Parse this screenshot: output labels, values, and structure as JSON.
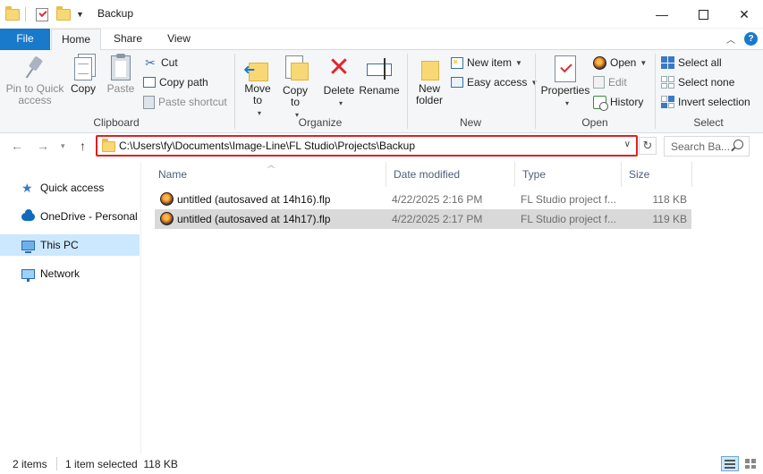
{
  "window": {
    "title": "Backup",
    "minimize": "—",
    "close": "✕"
  },
  "tabs": [
    {
      "label": "File"
    },
    {
      "label": "Home"
    },
    {
      "label": "Share"
    },
    {
      "label": "View"
    }
  ],
  "help_icon_label": "?",
  "ribbon": {
    "clipboard": {
      "label": "Clipboard",
      "pin": "Pin to Quick access",
      "copy": "Copy",
      "paste": "Paste",
      "cut": "Cut",
      "copy_path": "Copy path",
      "paste_shortcut": "Paste shortcut"
    },
    "organize": {
      "label": "Organize",
      "move_to": "Move to",
      "copy_to": "Copy to",
      "delete": "Delete",
      "rename": "Rename"
    },
    "new": {
      "label": "New",
      "new_folder": "New folder",
      "new_item": "New item",
      "easy_access": "Easy access"
    },
    "open": {
      "label": "Open",
      "properties": "Properties",
      "open": "Open",
      "edit": "Edit",
      "history": "History"
    },
    "select": {
      "label": "Select",
      "select_all": "Select all",
      "select_none": "Select none",
      "invert_selection": "Invert selection"
    }
  },
  "address": {
    "path": "C:\\Users\\fy\\Documents\\Image-Line\\FL Studio\\Projects\\Backup",
    "search_placeholder": "Search Ba..."
  },
  "nav_pane": [
    {
      "label": "Quick access",
      "icon": "star-icon"
    },
    {
      "label": "OneDrive - Personal",
      "icon": "cloud-icon"
    },
    {
      "label": "This PC",
      "icon": "computer-icon",
      "selected": true
    },
    {
      "label": "Network",
      "icon": "network-icon"
    }
  ],
  "columns": {
    "name": "Name",
    "date": "Date modified",
    "type": "Type",
    "size": "Size"
  },
  "files": [
    {
      "name": "untitled (autosaved at 14h16).flp",
      "date": "4/22/2025 2:16 PM",
      "type": "FL Studio project f...",
      "size": "118 KB",
      "selected": false
    },
    {
      "name": "untitled (autosaved at 14h17).flp",
      "date": "4/22/2025 2:17 PM",
      "type": "FL Studio project f...",
      "size": "119 KB",
      "selected": true
    }
  ],
  "status": {
    "items": "2 items",
    "selection": "1 item selected  118 KB"
  }
}
